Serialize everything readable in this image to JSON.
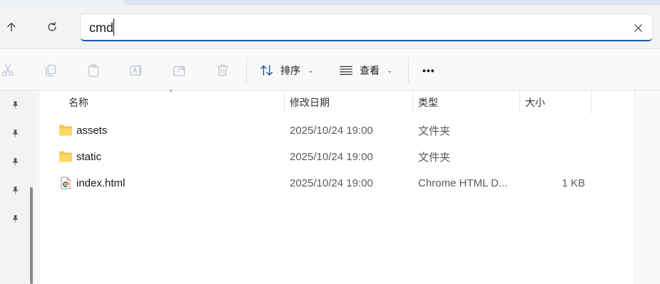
{
  "address": {
    "value": "cmd"
  },
  "commandbar": {
    "sort_label": "排序",
    "view_label": "查看",
    "more_label": "•••"
  },
  "columns": {
    "name": "名称",
    "modified": "修改日期",
    "type": "类型",
    "size": "大小"
  },
  "files": [
    {
      "name": "assets",
      "modified": "2025/10/24 19:00",
      "type": "文件夹",
      "size": "",
      "icon": "folder-icon"
    },
    {
      "name": "static",
      "modified": "2025/10/24 19:00",
      "type": "文件夹",
      "size": "",
      "icon": "folder-icon"
    },
    {
      "name": "index.html",
      "modified": "2025/10/24 19:00",
      "type": "Chrome HTML D...",
      "size": "1 KB",
      "icon": "chrome-html-icon"
    }
  ],
  "colors": {
    "accent": "#1c5fb8",
    "folder": "#f4c54a"
  }
}
